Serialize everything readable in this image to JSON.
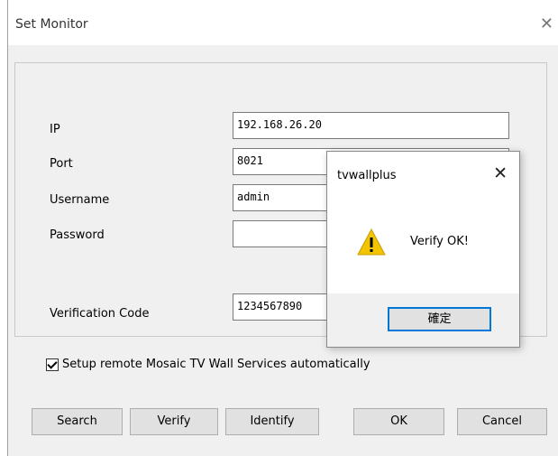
{
  "window": {
    "title": "Set Monitor",
    "close_glyph": "✕"
  },
  "form": {
    "ip_label": "IP",
    "ip_value": "192.168.26.20",
    "port_label": "Port",
    "port_value": "8021",
    "username_label": "Username",
    "username_value": "admin",
    "password_label": "Password",
    "password_value": "",
    "verification_label": "Verification Code",
    "verification_value": "1234567890"
  },
  "checkbox": {
    "label": "Setup remote Mosaic TV Wall Services automatically",
    "checked": true
  },
  "buttons": {
    "search": "Search",
    "verify": "Verify",
    "identify": "Identify",
    "ok": "OK",
    "cancel": "Cancel"
  },
  "message_box": {
    "title": "tvwallplus",
    "text": "Verify OK!",
    "ok_label": "確定",
    "icon": "warning-icon",
    "close_glyph": "✕"
  },
  "colors": {
    "focus_border": "#0078d7",
    "warning_yellow": "#f2c500"
  }
}
